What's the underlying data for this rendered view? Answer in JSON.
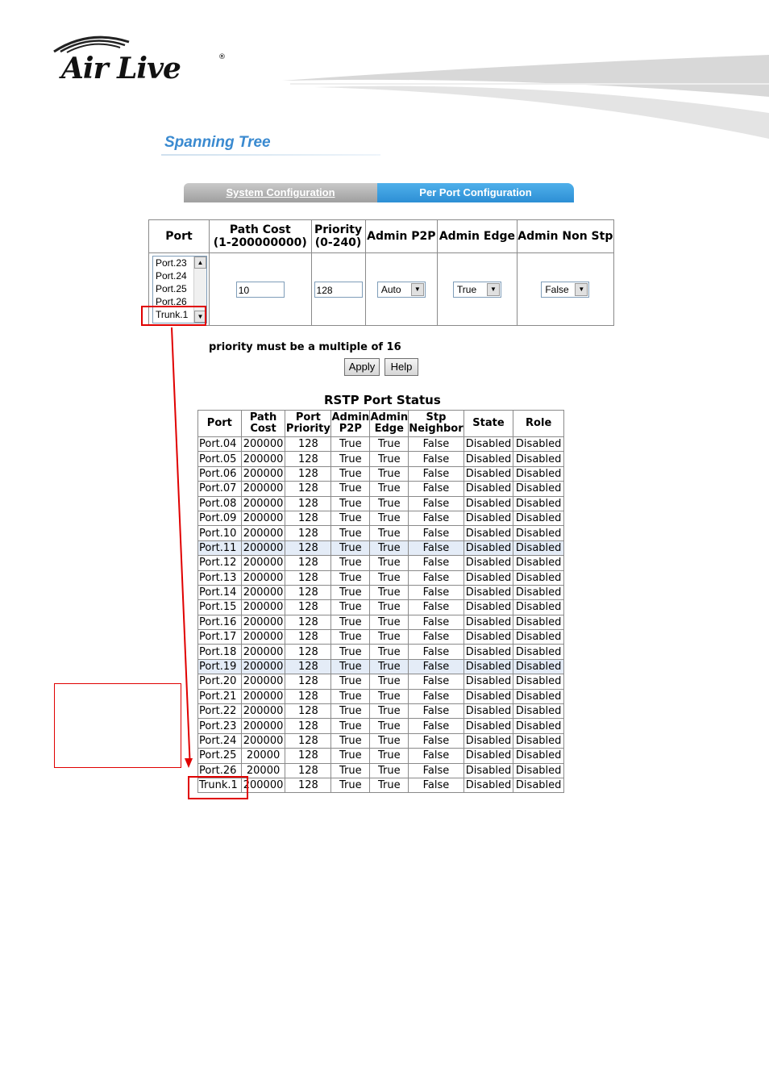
{
  "header": {
    "logo_text": "Air Live",
    "logo_reg": "®"
  },
  "page": {
    "title": "Spanning Tree"
  },
  "tabs": [
    {
      "label": "System Configuration",
      "active": false
    },
    {
      "label": "Per Port Configuration",
      "active": true
    }
  ],
  "config": {
    "headers": {
      "port": "Port",
      "path_cost_1": "Path Cost",
      "path_cost_2": "(1-200000000)",
      "priority_1": "Priority",
      "priority_2": "(0-240)",
      "admin_p2p": "Admin P2P",
      "admin_edge": "Admin Edge",
      "admin_non_stp": "Admin Non Stp"
    },
    "port_options": [
      "Port.23",
      "Port.24",
      "Port.25",
      "Port.26",
      "Trunk.1"
    ],
    "path_cost_value": "10",
    "priority_value": "128",
    "admin_p2p_value": "Auto",
    "admin_edge_value": "True",
    "admin_non_stp_value": "False"
  },
  "note": "priority must be a multiple of 16",
  "buttons": {
    "apply": "Apply",
    "help": "Help"
  },
  "status": {
    "title": "RSTP Port Status",
    "headers": {
      "port": "Port",
      "path_cost_1": "Path",
      "path_cost_2": "Cost",
      "port_priority_1": "Port",
      "port_priority_2": "Priority",
      "admin_p2p_1": "Admin",
      "admin_p2p_2": "P2P",
      "admin_edge_1": "Admin",
      "admin_edge_2": "Edge",
      "stp_neighbor_1": "Stp",
      "stp_neighbor_2": "Neighbor",
      "state": "State",
      "role": "Role"
    },
    "rows": [
      [
        "Port.04",
        "200000",
        "128",
        "True",
        "True",
        "False",
        "Disabled",
        "Disabled"
      ],
      [
        "Port.05",
        "200000",
        "128",
        "True",
        "True",
        "False",
        "Disabled",
        "Disabled"
      ],
      [
        "Port.06",
        "200000",
        "128",
        "True",
        "True",
        "False",
        "Disabled",
        "Disabled"
      ],
      [
        "Port.07",
        "200000",
        "128",
        "True",
        "True",
        "False",
        "Disabled",
        "Disabled"
      ],
      [
        "Port.08",
        "200000",
        "128",
        "True",
        "True",
        "False",
        "Disabled",
        "Disabled"
      ],
      [
        "Port.09",
        "200000",
        "128",
        "True",
        "True",
        "False",
        "Disabled",
        "Disabled"
      ],
      [
        "Port.10",
        "200000",
        "128",
        "True",
        "True",
        "False",
        "Disabled",
        "Disabled"
      ],
      [
        "Port.11",
        "200000",
        "128",
        "True",
        "True",
        "False",
        "Disabled",
        "Disabled"
      ],
      [
        "Port.12",
        "200000",
        "128",
        "True",
        "True",
        "False",
        "Disabled",
        "Disabled"
      ],
      [
        "Port.13",
        "200000",
        "128",
        "True",
        "True",
        "False",
        "Disabled",
        "Disabled"
      ],
      [
        "Port.14",
        "200000",
        "128",
        "True",
        "True",
        "False",
        "Disabled",
        "Disabled"
      ],
      [
        "Port.15",
        "200000",
        "128",
        "True",
        "True",
        "False",
        "Disabled",
        "Disabled"
      ],
      [
        "Port.16",
        "200000",
        "128",
        "True",
        "True",
        "False",
        "Disabled",
        "Disabled"
      ],
      [
        "Port.17",
        "200000",
        "128",
        "True",
        "True",
        "False",
        "Disabled",
        "Disabled"
      ],
      [
        "Port.18",
        "200000",
        "128",
        "True",
        "True",
        "False",
        "Disabled",
        "Disabled"
      ],
      [
        "Port.19",
        "200000",
        "128",
        "True",
        "True",
        "False",
        "Disabled",
        "Disabled"
      ],
      [
        "Port.20",
        "200000",
        "128",
        "True",
        "True",
        "False",
        "Disabled",
        "Disabled"
      ],
      [
        "Port.21",
        "200000",
        "128",
        "True",
        "True",
        "False",
        "Disabled",
        "Disabled"
      ],
      [
        "Port.22",
        "200000",
        "128",
        "True",
        "True",
        "False",
        "Disabled",
        "Disabled"
      ],
      [
        "Port.23",
        "200000",
        "128",
        "True",
        "True",
        "False",
        "Disabled",
        "Disabled"
      ],
      [
        "Port.24",
        "200000",
        "128",
        "True",
        "True",
        "False",
        "Disabled",
        "Disabled"
      ],
      [
        "Port.25",
        "20000",
        "128",
        "True",
        "True",
        "False",
        "Disabled",
        "Disabled"
      ],
      [
        "Port.26",
        "20000",
        "128",
        "True",
        "True",
        "False",
        "Disabled",
        "Disabled"
      ],
      [
        "Trunk.1",
        "200000",
        "128",
        "True",
        "True",
        "False",
        "Disabled",
        "Disabled"
      ]
    ],
    "highlighted_rows": [
      7,
      15
    ]
  },
  "colors": {
    "accent": "#3a8ad0",
    "active_tab": "#2d8fd5",
    "annotation": "#e00000"
  }
}
